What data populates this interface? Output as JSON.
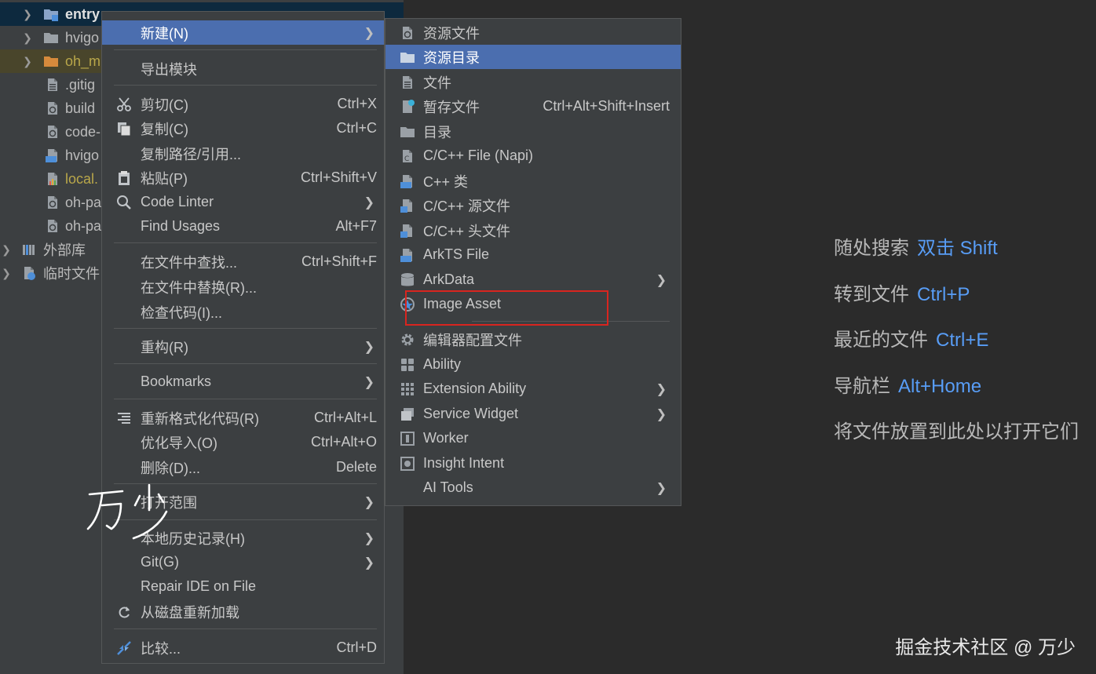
{
  "project_tree": {
    "items": [
      {
        "label": "entry",
        "type": "module-folder",
        "expanded": false,
        "selected": true
      },
      {
        "label": "hvigo",
        "type": "folder",
        "expanded": false
      },
      {
        "label": "oh_m",
        "type": "folder-orange",
        "expanded": false
      },
      {
        "label": ".gitig",
        "type": "file"
      },
      {
        "label": "build",
        "type": "config-file"
      },
      {
        "label": "code-",
        "type": "config-file"
      },
      {
        "label": "hvigo",
        "type": "ts-file"
      },
      {
        "label": "local.",
        "type": "properties-file"
      },
      {
        "label": "oh-pa",
        "type": "config-file"
      },
      {
        "label": "oh-pa",
        "type": "config-file"
      },
      {
        "label": "外部库",
        "type": "library"
      },
      {
        "label": "临时文件",
        "type": "scratches"
      }
    ]
  },
  "context_menu": {
    "items": [
      {
        "label": "新建(N)",
        "submenu": true,
        "active": true,
        "icon": ""
      },
      {
        "label": "导出模块",
        "icon": ""
      },
      {
        "label": "剪切(C)",
        "shortcut": "Ctrl+X",
        "icon": "scissors-icon"
      },
      {
        "label": "复制(C)",
        "shortcut": "Ctrl+C",
        "icon": "copy-icon"
      },
      {
        "label": "复制路径/引用...",
        "icon": ""
      },
      {
        "label": "粘贴(P)",
        "shortcut": "Ctrl+Shift+V",
        "icon": "paste-icon"
      },
      {
        "label": "Code Linter",
        "submenu": true,
        "icon": "code-linter-icon"
      },
      {
        "label": "Find Usages",
        "shortcut": "Alt+F7",
        "icon": ""
      },
      {
        "label": "在文件中查找...",
        "shortcut": "Ctrl+Shift+F",
        "icon": ""
      },
      {
        "label": "在文件中替换(R)...",
        "icon": ""
      },
      {
        "label": "检查代码(I)...",
        "icon": ""
      },
      {
        "label": "重构(R)",
        "submenu": true,
        "icon": ""
      },
      {
        "label": "Bookmarks",
        "submenu": true,
        "icon": ""
      },
      {
        "label": "重新格式化代码(R)",
        "shortcut": "Ctrl+Alt+L",
        "icon": "reformat-icon"
      },
      {
        "label": "优化导入(O)",
        "shortcut": "Ctrl+Alt+O",
        "icon": ""
      },
      {
        "label": "删除(D)...",
        "shortcut": "Delete",
        "icon": ""
      },
      {
        "label": "打开范围",
        "submenu": true,
        "icon": ""
      },
      {
        "label": "本地历史记录(H)",
        "submenu": true,
        "icon": ""
      },
      {
        "label": "Git(G)",
        "submenu": true,
        "icon": ""
      },
      {
        "label": "Repair IDE on File",
        "icon": ""
      },
      {
        "label": "从磁盘重新加载",
        "icon": "reload-icon"
      },
      {
        "label": "比较...",
        "shortcut": "Ctrl+D",
        "icon": "compare-icon"
      }
    ]
  },
  "new_submenu": {
    "items": [
      {
        "label": "资源文件",
        "icon": "resource-file-icon"
      },
      {
        "label": "资源目录",
        "icon": "folder-icon",
        "active": true
      },
      {
        "label": "文件",
        "icon": "file-icon"
      },
      {
        "label": "暂存文件",
        "shortcut": "Ctrl+Alt+Shift+Insert",
        "icon": "scratch-file-icon"
      },
      {
        "label": "目录",
        "icon": "directory-icon"
      },
      {
        "label": "C/C++ File (Napi)",
        "icon": "c-file-icon"
      },
      {
        "label": "C++ 类",
        "icon": "cpp-class-icon"
      },
      {
        "label": "C/C++ 源文件",
        "icon": "c-source-icon"
      },
      {
        "label": "C/C++ 头文件",
        "icon": "header-file-icon"
      },
      {
        "label": "ArkTS File",
        "icon": "ets-file-icon"
      },
      {
        "label": "ArkData",
        "submenu": true,
        "icon": "database-icon"
      },
      {
        "label": "Image Asset",
        "icon": "image-asset-icon"
      },
      {
        "label": "编辑器配置文件",
        "icon": "gear-icon"
      },
      {
        "label": "Ability",
        "icon": "ability-icon"
      },
      {
        "label": "Extension Ability",
        "submenu": true,
        "icon": "extension-ability-icon"
      },
      {
        "label": "Service Widget",
        "submenu": true,
        "icon": "service-widget-icon"
      },
      {
        "label": "Worker",
        "icon": "worker-icon"
      },
      {
        "label": "Insight Intent",
        "icon": "insight-intent-icon"
      },
      {
        "label": "AI Tools",
        "submenu": true,
        "icon": ""
      }
    ]
  },
  "welcome": {
    "tips": [
      {
        "label": "随处搜索",
        "key": "双击 Shift"
      },
      {
        "label": "转到文件",
        "key": "Ctrl+P"
      },
      {
        "label": "最近的文件",
        "key": "Ctrl+E"
      },
      {
        "label": "导航栏",
        "key": "Alt+Home"
      },
      {
        "label": "将文件放置到此处以打开它们",
        "key": ""
      }
    ]
  },
  "watermark": "掘金技术社区 @ 万少",
  "handwritten_signature": "万少",
  "colors": {
    "accent": "#4b6eaf",
    "shortcut_blue": "#589df6",
    "highlight_box": "#d9251f",
    "tree_bg": "#3c3f41",
    "editor_bg": "#2b2b2b"
  }
}
